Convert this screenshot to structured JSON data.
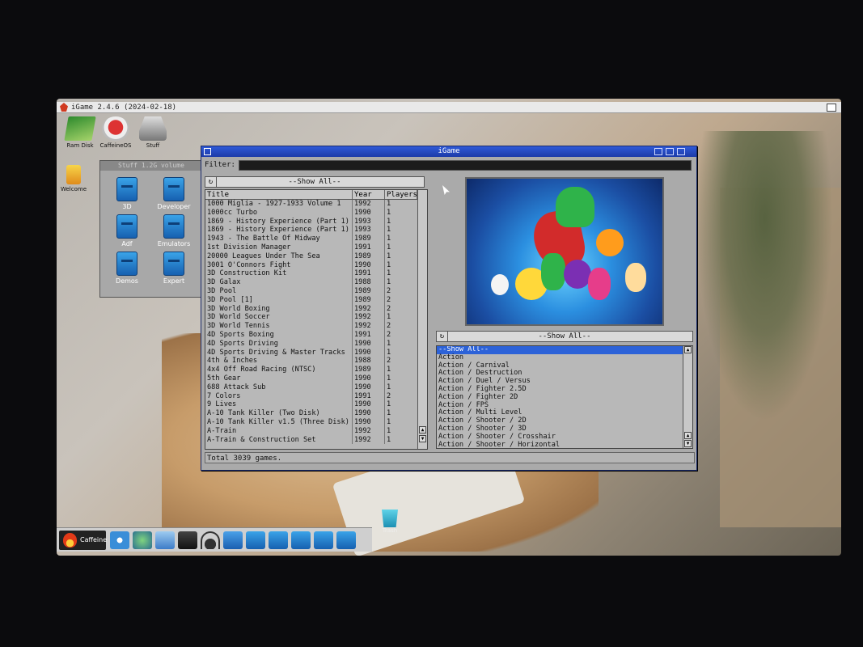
{
  "screen": {
    "title": "iGame 2.4.6 (2024-02-18)"
  },
  "desktop": {
    "icons": [
      {
        "label": "Ram Disk",
        "icon": "ram-disk-icon"
      },
      {
        "label": "CaffeineOS",
        "icon": "caffeine-os-icon"
      },
      {
        "label": "Stuff",
        "icon": "stuff-drive-icon"
      },
      {
        "label": "Welcome",
        "icon": "welcome-icon"
      }
    ],
    "stuff_window": {
      "title": "Stuff   1.2G volume",
      "drawers": [
        "3D",
        "Developer",
        "Adf",
        "Emulators",
        "Demos",
        "Expert"
      ]
    },
    "trash": {
      "label": "Trash"
    },
    "dock": {
      "start_label": "Caffeine"
    }
  },
  "igame": {
    "title": "iGame",
    "filter_label": "Filter:",
    "filter_value": "",
    "list_filter": "--Show All--",
    "genre_filter": "--Show All--",
    "columns": [
      "Title",
      "Year",
      "Players"
    ],
    "games": [
      [
        "1000 Miglia - 1927-1933 Volume 1",
        "1992",
        "1"
      ],
      [
        "1000cc Turbo",
        "1990",
        "1"
      ],
      [
        "1869 - History Experience (Part 1)",
        "1993",
        "1"
      ],
      [
        "1869 - History Experience (Part 1)",
        "1993",
        "1"
      ],
      [
        "1943 - The Battle Of Midway",
        "1989",
        "1"
      ],
      [
        "1st Division Manager",
        "1991",
        "1"
      ],
      [
        "20000 Leagues Under The Sea",
        "1989",
        "1"
      ],
      [
        "3001 O'Connors Fight",
        "1990",
        "1"
      ],
      [
        "3D Construction Kit",
        "1991",
        "1"
      ],
      [
        "3D Galax",
        "1988",
        "1"
      ],
      [
        "3D Pool",
        "1989",
        "2"
      ],
      [
        "3D Pool [1]",
        "1989",
        "2"
      ],
      [
        "3D World Boxing",
        "1992",
        "2"
      ],
      [
        "3D World Soccer",
        "1992",
        "1"
      ],
      [
        "3D World Tennis",
        "1992",
        "2"
      ],
      [
        "4D Sports Boxing",
        "1991",
        "2"
      ],
      [
        "4D Sports Driving",
        "1990",
        "1"
      ],
      [
        "4D Sports Driving & Master Tracks",
        "1990",
        "1"
      ],
      [
        "4th & Inches",
        "1988",
        "2"
      ],
      [
        "4x4 Off Road Racing (NTSC)",
        "1989",
        "1"
      ],
      [
        "5th Gear",
        "1990",
        "1"
      ],
      [
        "688 Attack Sub",
        "1990",
        "1"
      ],
      [
        "7 Colors",
        "1991",
        "2"
      ],
      [
        "9 Lives",
        "1990",
        "1"
      ],
      [
        "A-10 Tank Killer (Two Disk)",
        "1990",
        "1"
      ],
      [
        "A-10 Tank Killer v1.5 (Three Disk)",
        "1990",
        "1"
      ],
      [
        "A-Train",
        "1992",
        "1"
      ],
      [
        "A-Train & Construction Set",
        "1992",
        "1"
      ]
    ],
    "genres": [
      "--Show All--",
      "Action",
      "Action / Carnival",
      "Action / Destruction",
      "Action / Duel / Versus",
      "Action / Fighter 2.5D",
      "Action / Fighter 2D",
      "Action / FPS",
      "Action / Multi Level",
      "Action / Shooter / 2D",
      "Action / Shooter / 3D",
      "Action / Shooter / Crosshair",
      "Action / Shooter / Horizontal"
    ],
    "selected_genre_index": 0,
    "status": "Total 3039 games."
  }
}
